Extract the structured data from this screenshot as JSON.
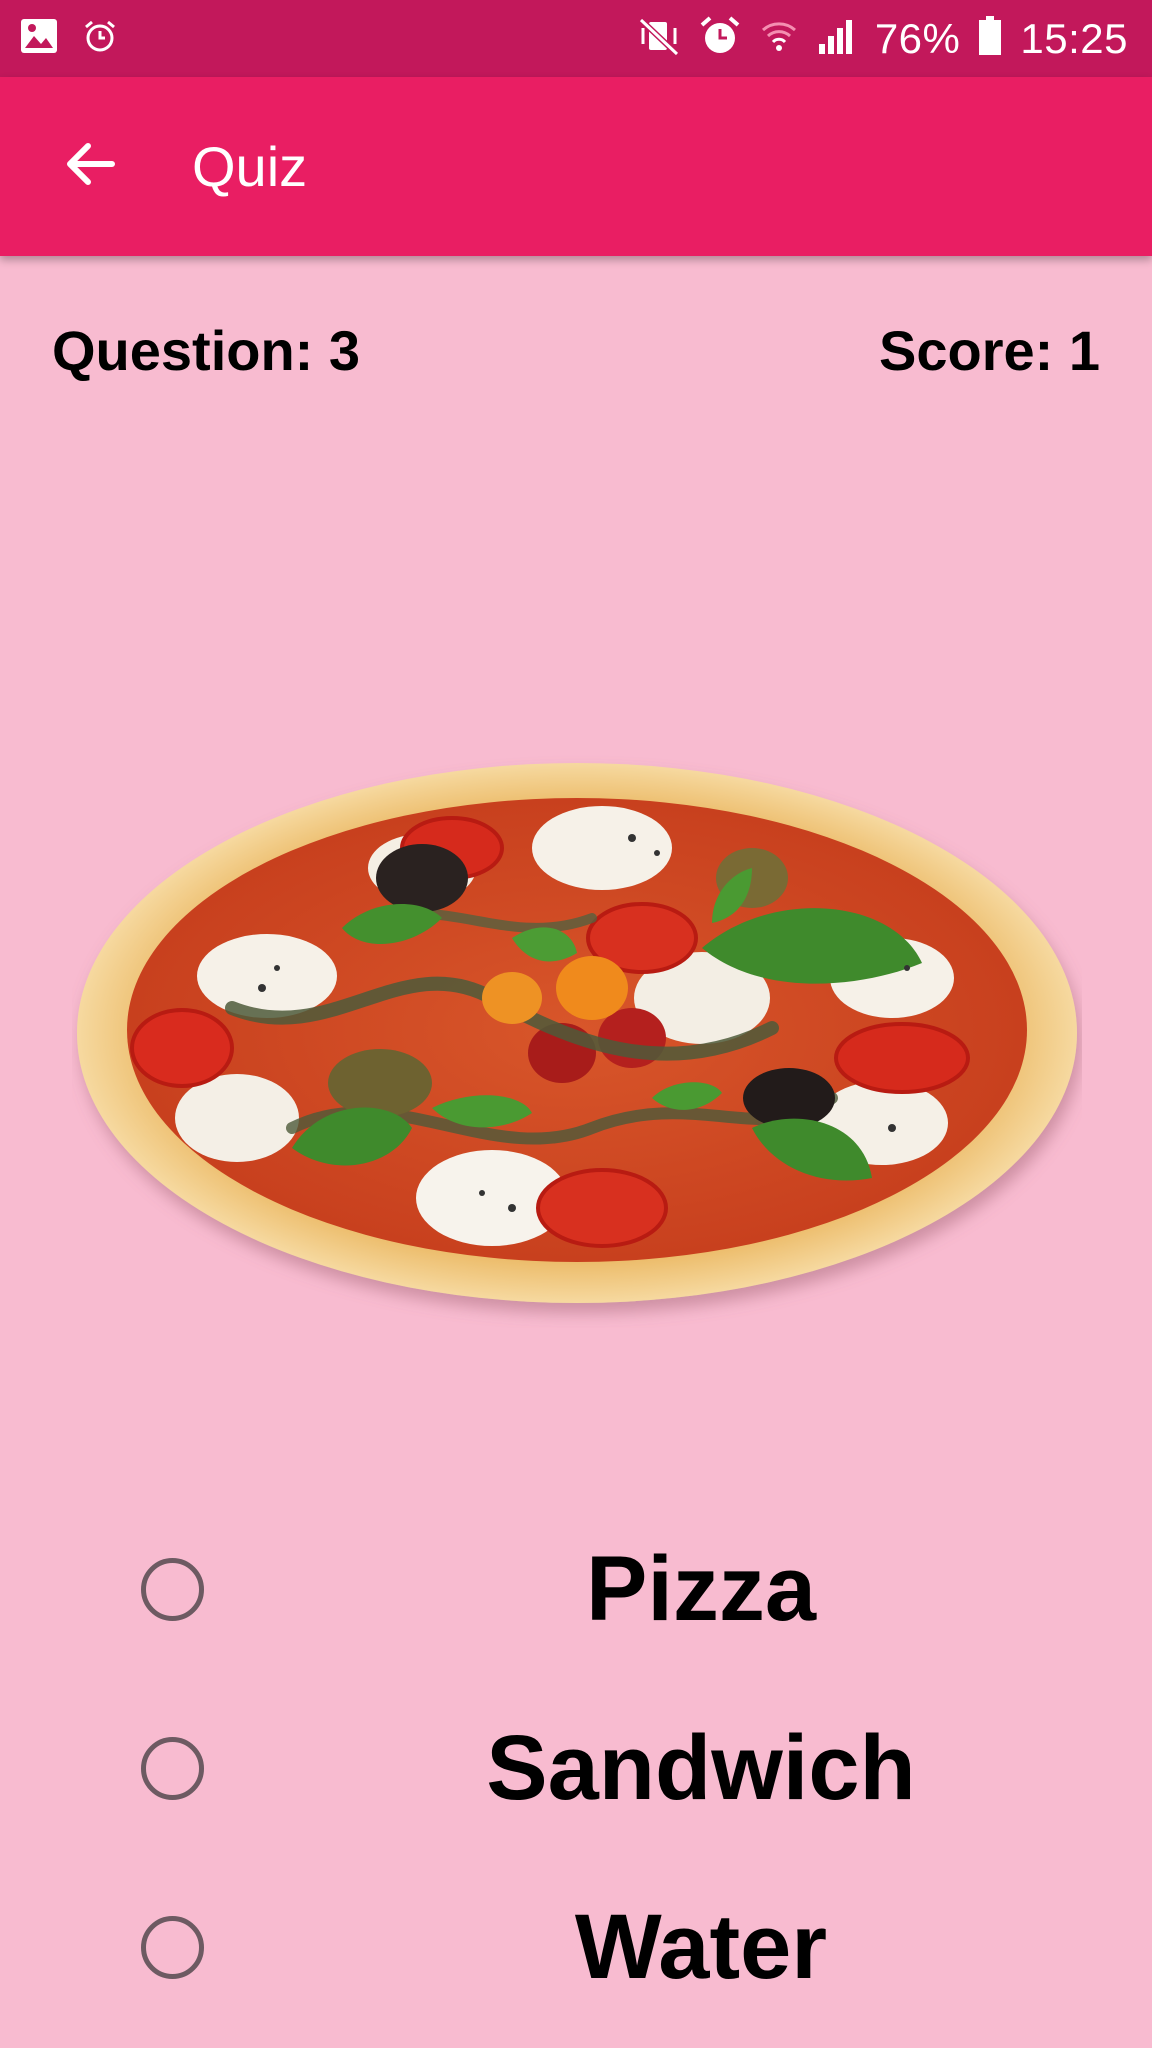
{
  "status_bar": {
    "battery": "76%",
    "time": "15:25",
    "icons": [
      "gallery-icon",
      "alarm-outline-icon",
      "mute-vibrate-icon",
      "alarm-icon",
      "wifi-icon",
      "signal-icon",
      "battery-icon"
    ]
  },
  "app_bar": {
    "title": "Quiz",
    "back_icon": "arrow-back-icon"
  },
  "quiz": {
    "question_label": "Question: 3",
    "score_label": "Score: 1",
    "image": "pizza-image",
    "options": [
      "Pizza",
      "Sandwich",
      "Water"
    ],
    "selected": null
  },
  "colors": {
    "status_bar": "#c2185b",
    "app_bar": "#e91e63",
    "background": "#f8bbd0"
  }
}
